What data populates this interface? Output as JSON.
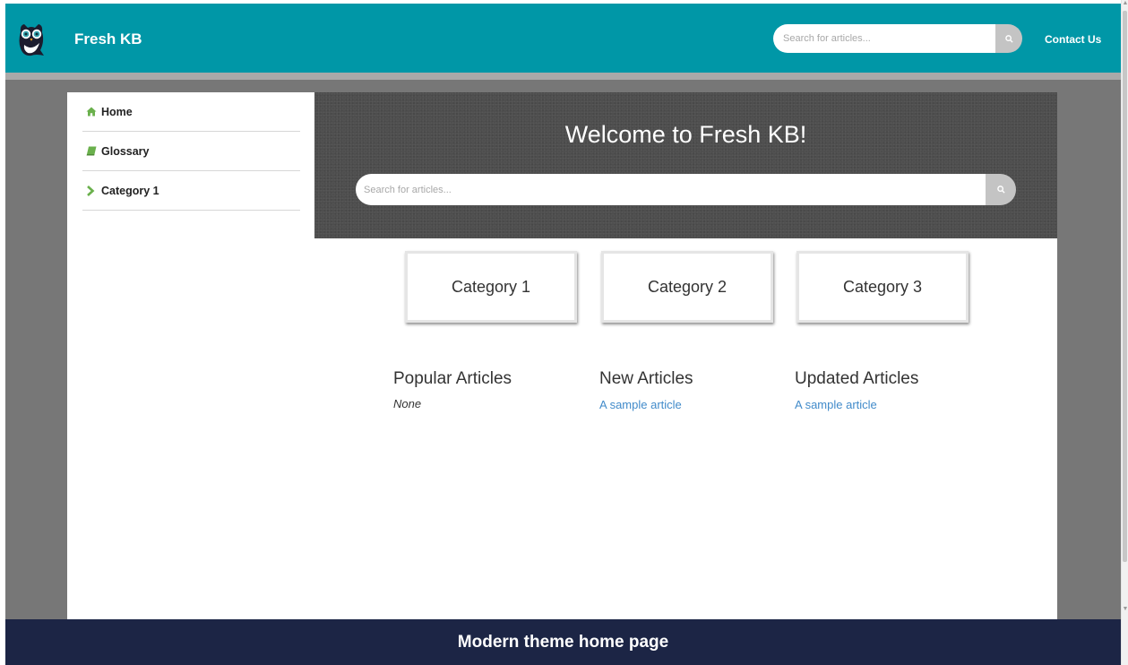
{
  "header": {
    "brand": "Fresh KB",
    "search_placeholder": "Search for articles...",
    "contact": "Contact Us",
    "color": "#0097a7"
  },
  "sidebar": {
    "items": [
      {
        "label": "Home",
        "icon": "home-icon",
        "icon_color": "#6ab04c"
      },
      {
        "label": "Glossary",
        "icon": "book-icon",
        "icon_color": "#6ab04c"
      },
      {
        "label": "Category 1",
        "icon": "chevron-right-icon",
        "icon_color": "#6ab04c"
      }
    ]
  },
  "hero": {
    "title": "Welcome to Fresh KB!",
    "search_placeholder": "Search for articles..."
  },
  "categories": [
    "Category 1",
    "Category 2",
    "Category 3"
  ],
  "columns": {
    "popular": {
      "title": "Popular Articles",
      "empty": "None"
    },
    "new": {
      "title": "New Articles",
      "link": "A sample article"
    },
    "updated": {
      "title": "Updated Articles",
      "link": "A sample article"
    }
  },
  "caption": "Modern theme home page",
  "colors": {
    "link": "#428bca",
    "caption_bg": "#1c2545"
  }
}
